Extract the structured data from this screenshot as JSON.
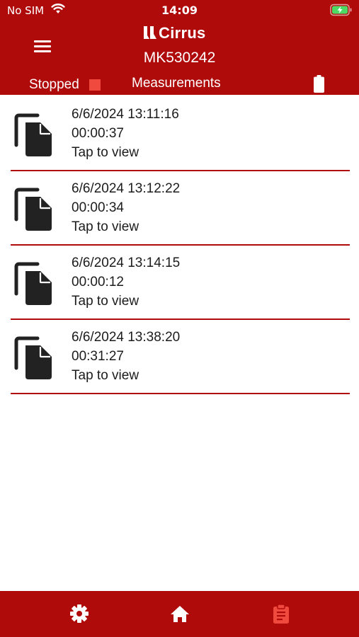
{
  "status_bar": {
    "carrier": "No SIM",
    "time": "14:09",
    "wifi_icon": "wifi-icon",
    "battery_icon": "battery-charging-icon"
  },
  "header": {
    "menu_icon": "hamburger-menu-icon",
    "brand": "Cirrus",
    "device_id": "MK530242",
    "status_label": "Stopped",
    "status_color": "#f04a3e",
    "title": "Measurements",
    "battery_icon": "battery-full-icon"
  },
  "measurements": [
    {
      "date": "6/6/2024 13:11:16",
      "duration": "00:00:37",
      "hint": "Tap to view"
    },
    {
      "date": "6/6/2024 13:12:22",
      "duration": "00:00:34",
      "hint": "Tap to view"
    },
    {
      "date": "6/6/2024 13:14:15",
      "duration": "00:00:12",
      "hint": "Tap to view"
    },
    {
      "date": "6/6/2024 13:38:20",
      "duration": "00:31:27",
      "hint": "Tap to view"
    }
  ],
  "bottom_nav": {
    "items": [
      {
        "icon": "settings-gear-icon",
        "active": false
      },
      {
        "icon": "home-icon",
        "active": false
      },
      {
        "icon": "clipboard-icon",
        "active": true
      }
    ]
  },
  "colors": {
    "brand_red": "#b00b0b",
    "active_tab": "#f04a3e",
    "text_dark": "#1c1c1c"
  }
}
